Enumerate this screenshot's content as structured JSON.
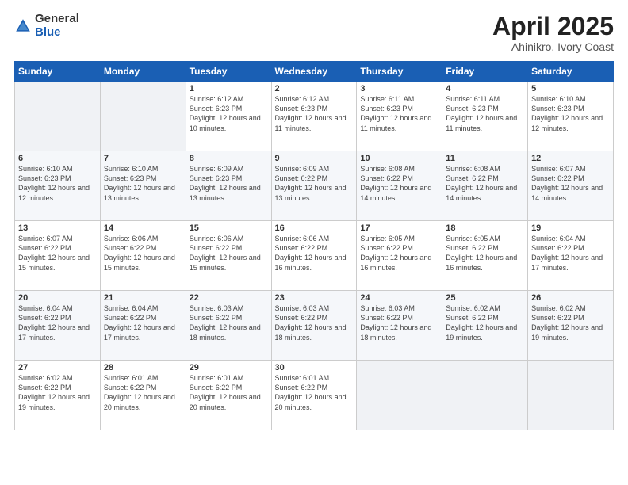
{
  "header": {
    "logo_general": "General",
    "logo_blue": "Blue",
    "title": "April 2025",
    "location": "Ahinikro, Ivory Coast"
  },
  "days_of_week": [
    "Sunday",
    "Monday",
    "Tuesday",
    "Wednesday",
    "Thursday",
    "Friday",
    "Saturday"
  ],
  "weeks": [
    [
      {
        "day": "",
        "info": ""
      },
      {
        "day": "",
        "info": ""
      },
      {
        "day": "1",
        "info": "Sunrise: 6:12 AM\nSunset: 6:23 PM\nDaylight: 12 hours and 10 minutes."
      },
      {
        "day": "2",
        "info": "Sunrise: 6:12 AM\nSunset: 6:23 PM\nDaylight: 12 hours and 11 minutes."
      },
      {
        "day": "3",
        "info": "Sunrise: 6:11 AM\nSunset: 6:23 PM\nDaylight: 12 hours and 11 minutes."
      },
      {
        "day": "4",
        "info": "Sunrise: 6:11 AM\nSunset: 6:23 PM\nDaylight: 12 hours and 11 minutes."
      },
      {
        "day": "5",
        "info": "Sunrise: 6:10 AM\nSunset: 6:23 PM\nDaylight: 12 hours and 12 minutes."
      }
    ],
    [
      {
        "day": "6",
        "info": "Sunrise: 6:10 AM\nSunset: 6:23 PM\nDaylight: 12 hours and 12 minutes."
      },
      {
        "day": "7",
        "info": "Sunrise: 6:10 AM\nSunset: 6:23 PM\nDaylight: 12 hours and 13 minutes."
      },
      {
        "day": "8",
        "info": "Sunrise: 6:09 AM\nSunset: 6:23 PM\nDaylight: 12 hours and 13 minutes."
      },
      {
        "day": "9",
        "info": "Sunrise: 6:09 AM\nSunset: 6:22 PM\nDaylight: 12 hours and 13 minutes."
      },
      {
        "day": "10",
        "info": "Sunrise: 6:08 AM\nSunset: 6:22 PM\nDaylight: 12 hours and 14 minutes."
      },
      {
        "day": "11",
        "info": "Sunrise: 6:08 AM\nSunset: 6:22 PM\nDaylight: 12 hours and 14 minutes."
      },
      {
        "day": "12",
        "info": "Sunrise: 6:07 AM\nSunset: 6:22 PM\nDaylight: 12 hours and 14 minutes."
      }
    ],
    [
      {
        "day": "13",
        "info": "Sunrise: 6:07 AM\nSunset: 6:22 PM\nDaylight: 12 hours and 15 minutes."
      },
      {
        "day": "14",
        "info": "Sunrise: 6:06 AM\nSunset: 6:22 PM\nDaylight: 12 hours and 15 minutes."
      },
      {
        "day": "15",
        "info": "Sunrise: 6:06 AM\nSunset: 6:22 PM\nDaylight: 12 hours and 15 minutes."
      },
      {
        "day": "16",
        "info": "Sunrise: 6:06 AM\nSunset: 6:22 PM\nDaylight: 12 hours and 16 minutes."
      },
      {
        "day": "17",
        "info": "Sunrise: 6:05 AM\nSunset: 6:22 PM\nDaylight: 12 hours and 16 minutes."
      },
      {
        "day": "18",
        "info": "Sunrise: 6:05 AM\nSunset: 6:22 PM\nDaylight: 12 hours and 16 minutes."
      },
      {
        "day": "19",
        "info": "Sunrise: 6:04 AM\nSunset: 6:22 PM\nDaylight: 12 hours and 17 minutes."
      }
    ],
    [
      {
        "day": "20",
        "info": "Sunrise: 6:04 AM\nSunset: 6:22 PM\nDaylight: 12 hours and 17 minutes."
      },
      {
        "day": "21",
        "info": "Sunrise: 6:04 AM\nSunset: 6:22 PM\nDaylight: 12 hours and 17 minutes."
      },
      {
        "day": "22",
        "info": "Sunrise: 6:03 AM\nSunset: 6:22 PM\nDaylight: 12 hours and 18 minutes."
      },
      {
        "day": "23",
        "info": "Sunrise: 6:03 AM\nSunset: 6:22 PM\nDaylight: 12 hours and 18 minutes."
      },
      {
        "day": "24",
        "info": "Sunrise: 6:03 AM\nSunset: 6:22 PM\nDaylight: 12 hours and 18 minutes."
      },
      {
        "day": "25",
        "info": "Sunrise: 6:02 AM\nSunset: 6:22 PM\nDaylight: 12 hours and 19 minutes."
      },
      {
        "day": "26",
        "info": "Sunrise: 6:02 AM\nSunset: 6:22 PM\nDaylight: 12 hours and 19 minutes."
      }
    ],
    [
      {
        "day": "27",
        "info": "Sunrise: 6:02 AM\nSunset: 6:22 PM\nDaylight: 12 hours and 19 minutes."
      },
      {
        "day": "28",
        "info": "Sunrise: 6:01 AM\nSunset: 6:22 PM\nDaylight: 12 hours and 20 minutes."
      },
      {
        "day": "29",
        "info": "Sunrise: 6:01 AM\nSunset: 6:22 PM\nDaylight: 12 hours and 20 minutes."
      },
      {
        "day": "30",
        "info": "Sunrise: 6:01 AM\nSunset: 6:22 PM\nDaylight: 12 hours and 20 minutes."
      },
      {
        "day": "",
        "info": ""
      },
      {
        "day": "",
        "info": ""
      },
      {
        "day": "",
        "info": ""
      }
    ]
  ]
}
